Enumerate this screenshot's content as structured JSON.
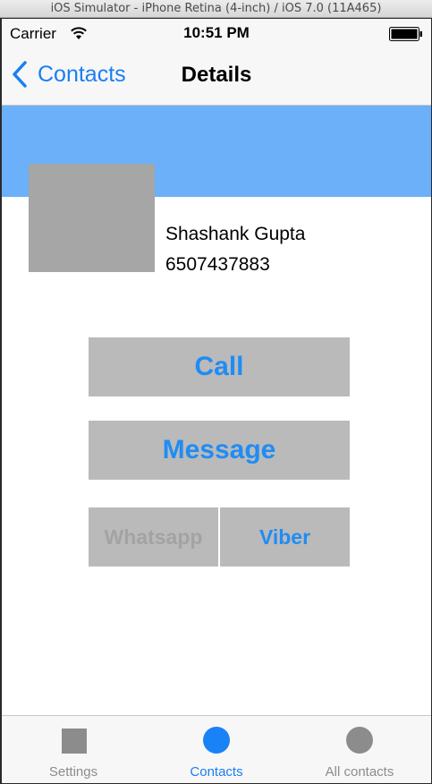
{
  "window": {
    "title": "iOS Simulator - iPhone Retina (4-inch) / iOS 7.0 (11A465)"
  },
  "status_bar": {
    "carrier": "Carrier",
    "time": "10:51 PM",
    "wifi_icon": "wifi-icon",
    "battery_icon": "battery-full-icon"
  },
  "nav": {
    "back_label": "Contacts",
    "back_icon": "chevron-left-icon",
    "title": "Details"
  },
  "colors": {
    "accent": "#1a7ef4",
    "banner": "#6bb0f9",
    "button_bg": "#bababa",
    "disabled_text": "#a3a3a3"
  },
  "contact": {
    "name": "Shashank Gupta",
    "phone": "6507437883"
  },
  "actions": {
    "call": "Call",
    "message": "Message",
    "whatsapp": "Whatsapp",
    "viber": "Viber"
  },
  "tabs": [
    {
      "label": "Settings",
      "icon": "square-icon",
      "active": false
    },
    {
      "label": "Contacts",
      "icon": "circle-icon",
      "active": true
    },
    {
      "label": "All contacts",
      "icon": "circle-icon",
      "active": false
    }
  ]
}
